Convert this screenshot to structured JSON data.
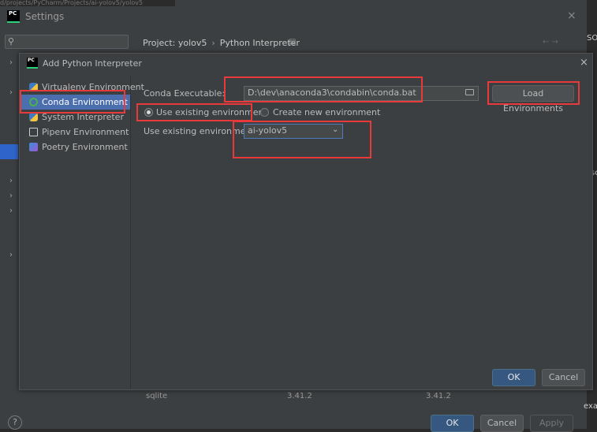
{
  "window": {
    "title": "Settings",
    "close_glyph": "×",
    "top_strip_text": "d/projects/PyCharm/Projects/ai-yolov5/yolov5",
    "right_strip": {
      "sota": "SOTA",
      "sc": "sc",
      "ex": "exa"
    }
  },
  "header": {
    "breadcrumb_project": "Project: yolov5",
    "breadcrumb_sep": "›",
    "breadcrumb_page": "Python Interpreter",
    "pin_glyph": "▤",
    "nav_arrows": "←  →"
  },
  "background_table": {
    "row_name": "sqlite",
    "version_1": "3.41.2",
    "version_2": "3.41.2"
  },
  "outer_buttons": {
    "ok": "OK",
    "cancel": "Cancel",
    "apply": "Apply",
    "help": "?"
  },
  "dialog": {
    "title": "Add Python Interpreter",
    "close_glyph": "×",
    "environments": [
      {
        "label": "Virtualenv Environment",
        "icon": "python-icon"
      },
      {
        "label": "Conda Environment",
        "icon": "conda-icon",
        "selected": true
      },
      {
        "label": "System Interpreter",
        "icon": "python-icon"
      },
      {
        "label": "Pipenv Environment",
        "icon": "pipenv-icon"
      },
      {
        "label": "Poetry Environment",
        "icon": "poetry-icon"
      }
    ],
    "conda_executable_label": "Conda Executable:",
    "conda_executable_value": "D:\\dev\\anaconda3\\condabin\\conda.bat",
    "load_environments_label": "Load Environments",
    "radio_existing_label": "Use existing environment",
    "radio_new_label": "Create new environment",
    "existing_env_label": "Use existing environment:",
    "existing_env_value": "ai-yolov5",
    "ok_label": "OK",
    "cancel_label": "Cancel"
  },
  "colors": {
    "accent": "#365880",
    "selection": "#4b6eaf",
    "annotation": "#e8393b"
  }
}
